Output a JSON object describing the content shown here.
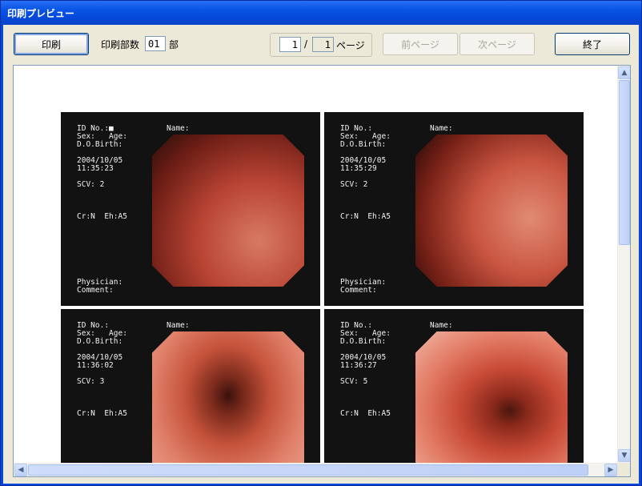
{
  "window": {
    "title": "印刷プレビュー"
  },
  "toolbar": {
    "print_label": "印刷",
    "copies_label": "印刷部数",
    "copies_value": "01",
    "copies_unit": "部",
    "page_current": "1",
    "page_sep": "/",
    "page_total": "1",
    "page_label": "ページ",
    "prev_label": "前ページ",
    "next_label": "次ページ",
    "close_label": "終了"
  },
  "report": {
    "cells": [
      {
        "id": "ID No.:",
        "id_value": "■",
        "name": "Name:",
        "sex_age": "Sex:   Age:",
        "dob": "D.O.Birth:",
        "date": "2004/10/05",
        "time": "11:35:23",
        "scv": "SCV: 2",
        "mode": "Cr:N  Eh:A5",
        "physician": "Physician:",
        "comment": "Comment:"
      },
      {
        "id": "ID No.:",
        "id_value": "",
        "name": "Name:",
        "sex_age": "Sex:   Age:",
        "dob": "D.O.Birth:",
        "date": "2004/10/05",
        "time": "11:35:29",
        "scv": "SCV: 2",
        "mode": "Cr:N  Eh:A5",
        "physician": "Physician:",
        "comment": "Comment:"
      },
      {
        "id": "ID No.:",
        "id_value": "",
        "name": "Name:",
        "sex_age": "Sex:   Age:",
        "dob": "D.O.Birth:",
        "date": "2004/10/05",
        "time": "11:36:02",
        "scv": "SCV: 3",
        "mode": "Cr:N  Eh:A5"
      },
      {
        "id": "ID No.:",
        "id_value": "",
        "name": "Name:",
        "sex_age": "Sex:   Age:",
        "dob": "D.O.Birth:",
        "date": "2004/10/05",
        "time": "11:36:27",
        "scv": "SCV: 5",
        "mode": "Cr:N  Eh:A5"
      }
    ]
  },
  "colors": {
    "titlebar": "#0a56e6",
    "dialog": "#ece9d8",
    "image_bg": "#121212"
  }
}
